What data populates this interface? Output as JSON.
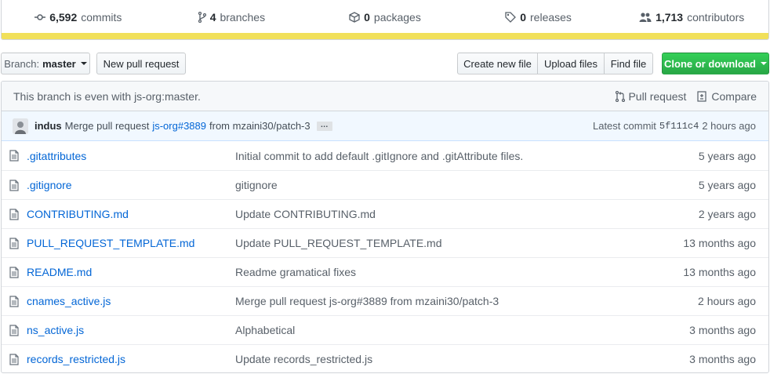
{
  "stats": {
    "commits": {
      "count": "6,592",
      "label": "commits",
      "icon": "commit-icon"
    },
    "branches": {
      "count": "4",
      "label": "branches",
      "icon": "branch-icon"
    },
    "packages": {
      "count": "0",
      "label": "packages",
      "icon": "package-icon"
    },
    "releases": {
      "count": "0",
      "label": "releases",
      "icon": "tag-icon"
    },
    "contributors": {
      "count": "1,713",
      "label": "contributors",
      "icon": "people-icon"
    },
    "language_color": "#f1e05a"
  },
  "toolbar": {
    "branch_label": "Branch:",
    "branch_value": "master",
    "new_pull_request": "New pull request",
    "create_new_file": "Create new file",
    "upload_files": "Upload files",
    "find_file": "Find file",
    "clone_or_download": "Clone or download"
  },
  "branch_info": {
    "message": "This branch is even with js-org:master.",
    "pull_request": "Pull request",
    "compare": "Compare"
  },
  "latest_commit": {
    "author": "indus",
    "message_prefix": "Merge pull request",
    "pr_link": "js-org#3889",
    "message_suffix": "from mzaini30/patch-3",
    "ellipsis": "…",
    "latest_label": "Latest commit",
    "sha": "5f111c4",
    "age": "2 hours ago"
  },
  "files": [
    {
      "name": ".gitattributes",
      "message": "Initial commit to add default .gitIgnore and .gitAttribute files.",
      "age": "5 years ago"
    },
    {
      "name": ".gitignore",
      "message": "gitignore",
      "age": "5 years ago"
    },
    {
      "name": "CONTRIBUTING.md",
      "message": "Update CONTRIBUTING.md",
      "age": "2 years ago"
    },
    {
      "name": "PULL_REQUEST_TEMPLATE.md",
      "message": "Update PULL_REQUEST_TEMPLATE.md",
      "age": "13 months ago"
    },
    {
      "name": "README.md",
      "message": "Readme gramatical fixes",
      "age": "13 months ago"
    },
    {
      "name": "cnames_active.js",
      "message": "Merge pull request js-org#3889 from mzaini30/patch-3",
      "age": "2 hours ago"
    },
    {
      "name": "ns_active.js",
      "message": "Alphabetical",
      "age": "3 months ago"
    },
    {
      "name": "records_restricted.js",
      "message": "Update records_restricted.js",
      "age": "3 months ago"
    }
  ]
}
